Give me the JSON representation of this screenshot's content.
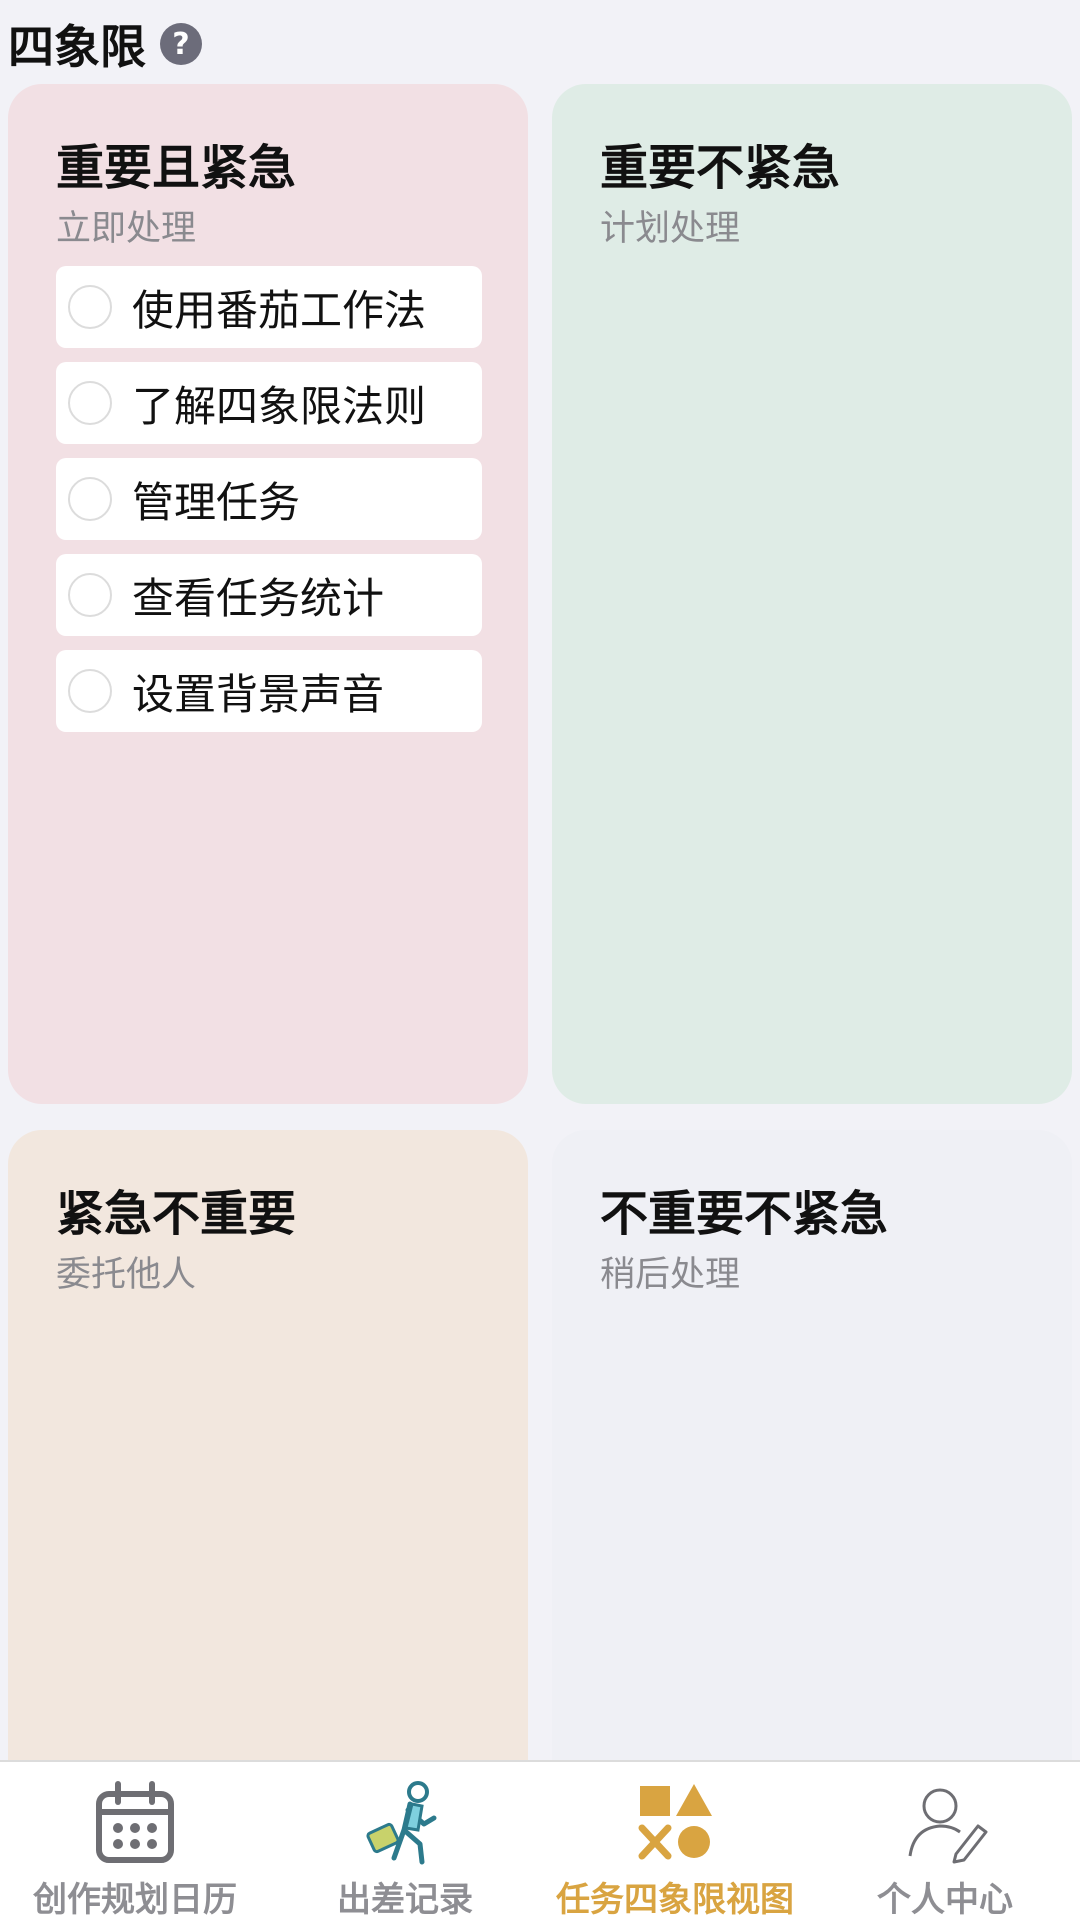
{
  "header": {
    "title": "四象限",
    "help_glyph": "?"
  },
  "quadrants": [
    {
      "title": "重要且紧急",
      "subtitle": "立即处理",
      "color": "#f2e0e4",
      "tasks": [
        "使用番茄工作法",
        "了解四象限法则",
        "管理任务",
        "查看任务统计",
        "设置背景声音"
      ]
    },
    {
      "title": "重要不紧急",
      "subtitle": "计划处理",
      "color": "#dfece6",
      "tasks": []
    },
    {
      "title": "紧急不重要",
      "subtitle": "委托他人",
      "color": "#f2e7de",
      "tasks": []
    },
    {
      "title": "不重要不紧急",
      "subtitle": "稍后处理",
      "color": "#eff0f5",
      "tasks": []
    }
  ],
  "tabbar": {
    "tabs": [
      {
        "label": "创作规划日历",
        "icon": "calendar-icon",
        "active": false
      },
      {
        "label": "出差记录",
        "icon": "traveler-icon",
        "active": false
      },
      {
        "label": "任务四象限视图",
        "icon": "shapes-icon",
        "active": true
      },
      {
        "label": "个人中心",
        "icon": "user-edit-icon",
        "active": false
      }
    ],
    "active_color": "#d9a441",
    "inactive_color": "#8e8e93"
  }
}
